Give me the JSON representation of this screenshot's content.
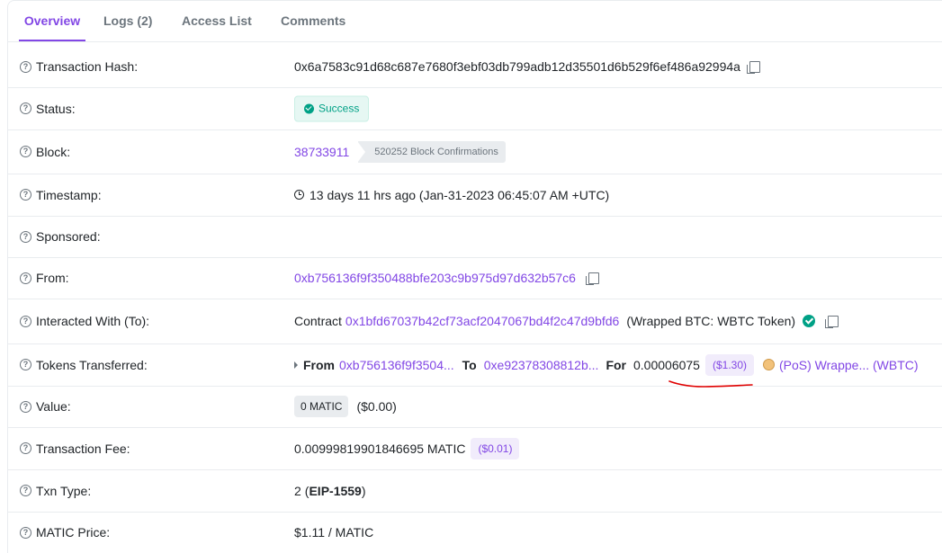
{
  "tabs": [
    {
      "label": "Overview"
    },
    {
      "label": "Logs (2)"
    },
    {
      "label": "Access List"
    },
    {
      "label": "Comments"
    }
  ],
  "rows": {
    "tx_hash": {
      "label": "Transaction Hash:",
      "value": "0x6a7583c91d68c687e7680f3ebf03db799adb12d35501d6b529f6ef486a92994a"
    },
    "status": {
      "label": "Status:",
      "value": "Success"
    },
    "block": {
      "label": "Block:",
      "value": "38733911",
      "confirmations": "520252 Block Confirmations"
    },
    "timestamp": {
      "label": "Timestamp:",
      "value": "13 days 11 hrs ago (Jan-31-2023 06:45:07 AM +UTC)"
    },
    "sponsored": {
      "label": "Sponsored:"
    },
    "from": {
      "label": "From:",
      "value": "0xb756136f9f350488bfe203c9b975d97d632b57c6"
    },
    "interacted": {
      "label": "Interacted With (To):",
      "prefix": "Contract",
      "address": "0x1bfd67037b42cf73acf2047067bd4f2c47d9bfd6",
      "name": "(Wrapped BTC: WBTC Token)"
    },
    "tokens": {
      "label": "Tokens Transferred:",
      "from_label": "From",
      "from_addr": "0xb756136f9f3504...",
      "to_label": "To",
      "to_addr": "0xe92378308812b...",
      "for_label": "For",
      "amount": "0.00006075",
      "usd": "($1.30)",
      "token": "(PoS) Wrappe... (WBTC)"
    },
    "value": {
      "label": "Value:",
      "amount": "0 MATIC",
      "usd": "($0.00)"
    },
    "fee": {
      "label": "Transaction Fee:",
      "amount": "0.00999819901846695 MATIC",
      "usd": "($0.01)"
    },
    "txn_type": {
      "label": "Txn Type:",
      "num": "2",
      "type": "EIP-1559"
    },
    "price": {
      "label": "MATIC Price:",
      "value": "$1.11 / MATIC"
    }
  },
  "colors": {
    "accent": "#8247e5",
    "success": "#00a186",
    "annotation": "#e00000"
  }
}
